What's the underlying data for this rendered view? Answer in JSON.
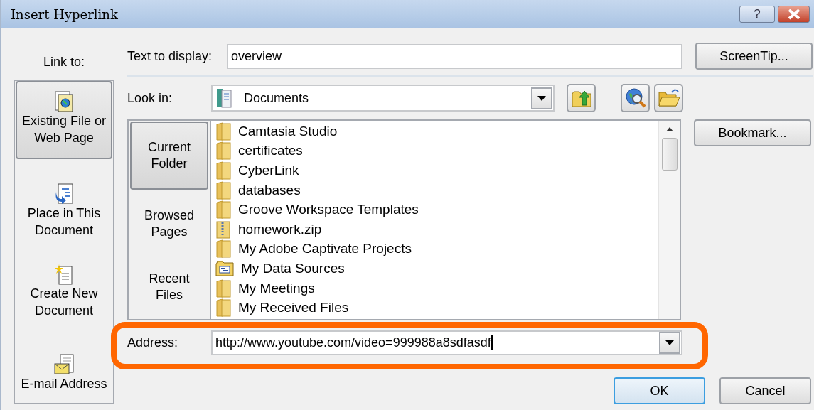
{
  "window": {
    "title": "Insert Hyperlink",
    "help_label": "?"
  },
  "link_to": {
    "label": "Link to:",
    "items": [
      {
        "label": "Existing File or Web Page",
        "kind": "file",
        "selected": true
      },
      {
        "label": "Place in This Document",
        "kind": "place",
        "selected": false
      },
      {
        "label": "Create New Document",
        "kind": "new",
        "selected": false
      },
      {
        "label": "E-mail Address",
        "kind": "email",
        "selected": false
      }
    ]
  },
  "text_to_display": {
    "label": "Text to display:",
    "value": "overview"
  },
  "screentip_button": "ScreenTip...",
  "look_in": {
    "label": "Look in:",
    "value": "Documents"
  },
  "browse": [
    {
      "label": "Current Folder",
      "selected": true
    },
    {
      "label": "Browsed Pages",
      "selected": false
    },
    {
      "label": "Recent Files",
      "selected": false
    }
  ],
  "files": [
    {
      "name": "Camtasia Studio",
      "kind": "folder"
    },
    {
      "name": "certificates",
      "kind": "folder"
    },
    {
      "name": "CyberLink",
      "kind": "folder"
    },
    {
      "name": "databases",
      "kind": "folder"
    },
    {
      "name": "Groove Workspace Templates",
      "kind": "folder"
    },
    {
      "name": "homework.zip",
      "kind": "zip"
    },
    {
      "name": "My Adobe Captivate Projects",
      "kind": "folder"
    },
    {
      "name": "My Data Sources",
      "kind": "datasource"
    },
    {
      "name": "My Meetings",
      "kind": "folder"
    },
    {
      "name": "My Received Files",
      "kind": "folder"
    }
  ],
  "bookmark_button": "Bookmark...",
  "address": {
    "label": "Address:",
    "value": "http://www.youtube.com/video=999988a8sdfasdf"
  },
  "buttons": [
    {
      "label": "OK",
      "default": true
    },
    {
      "label": "Cancel",
      "default": false
    }
  ]
}
